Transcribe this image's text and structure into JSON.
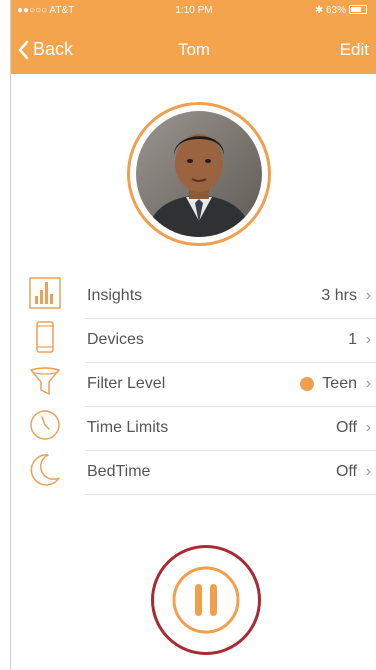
{
  "status_bar": {
    "carrier": "●●○○○ AT&T",
    "time": "1:10 PM",
    "battery": "✱ 63%"
  },
  "nav": {
    "back_label": "Back",
    "title": "Tom",
    "edit_label": "Edit"
  },
  "colors": {
    "accent": "#f4a44c",
    "pause_outline": "#a92a33"
  },
  "menu": [
    {
      "label": "Insights",
      "value": "3 hrs",
      "icon": "bar-chart-icon"
    },
    {
      "label": "Devices",
      "value": "1",
      "icon": "phone-icon"
    },
    {
      "label": "Filter Level",
      "value": "Teen",
      "icon": "funnel-icon"
    },
    {
      "label": "Time Limits",
      "value": "Off",
      "icon": "clock-icon"
    },
    {
      "label": "BedTime",
      "value": "Off",
      "icon": "moon-icon"
    }
  ],
  "pause_icon": "pause-icon"
}
